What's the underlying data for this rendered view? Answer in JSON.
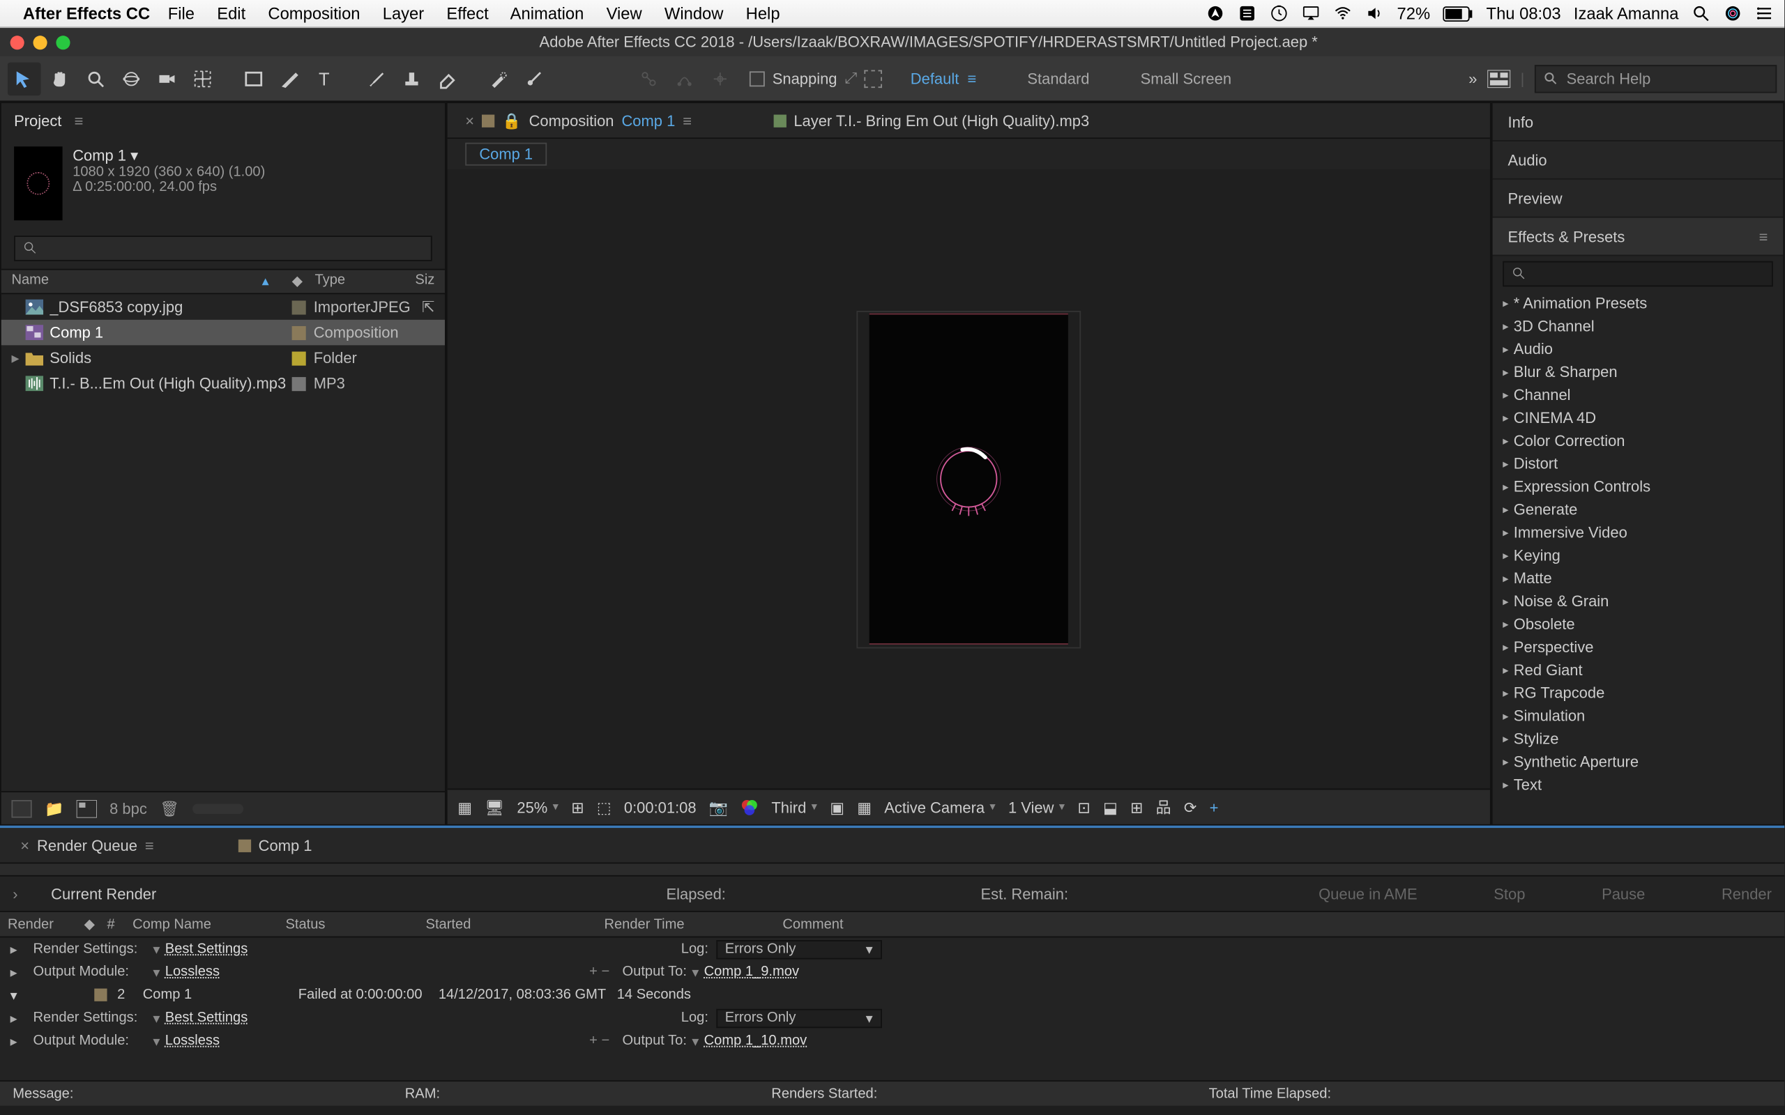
{
  "menubar": {
    "app": "After Effects CC",
    "items": [
      "File",
      "Edit",
      "Composition",
      "Layer",
      "Effect",
      "Animation",
      "View",
      "Window",
      "Help"
    ],
    "battery": "72%",
    "time": "Thu 08:03",
    "user": "Izaak Amanna"
  },
  "titlebar": {
    "title": "Adobe After Effects CC 2018 - /Users/Izaak/BOXRAW/IMAGES/SPOTIFY/HRDERASTSMRT/Untitled Project.aep *"
  },
  "toolbar": {
    "snapping": "Snapping",
    "workspaces": [
      "Default",
      "Standard",
      "Small Screen"
    ],
    "search_placeholder": "Search Help"
  },
  "project": {
    "panel_title": "Project",
    "comp_name": "Comp 1 ▾",
    "dims": "1080 x 1920  (360 x 640) (1.00)",
    "duration": "Δ 0:25:00:00, 24.00 fps",
    "cols": {
      "name": "Name",
      "label": "◆",
      "type": "Type",
      "size": "Siz"
    },
    "items": [
      {
        "name": "_DSF6853 copy.jpg",
        "type": "ImporterJPEG",
        "color": "#6b6753",
        "hasChild": false,
        "sel": false,
        "icon": "img"
      },
      {
        "name": "Comp 1",
        "type": "Composition",
        "color": "#8a7a5a",
        "hasChild": false,
        "sel": true,
        "icon": "comp"
      },
      {
        "name": "Solids",
        "type": "Folder",
        "color": "#b8a632",
        "hasChild": true,
        "sel": false,
        "icon": "folder"
      },
      {
        "name": "T.I.- B...Em Out (High Quality).mp3",
        "type": "MP3",
        "color": "#777",
        "hasChild": false,
        "sel": false,
        "icon": "audio"
      }
    ],
    "bpc": "8 bpc"
  },
  "composition": {
    "tab1_prefix": "Composition ",
    "tab1_name": "Comp 1",
    "tab2": "Layer T.I.- Bring Em Out (High Quality).mp3",
    "crumb": "Comp 1",
    "zoom": "25%",
    "time": "0:00:01:08",
    "quality": "Third",
    "camera": "Active Camera",
    "views": "1 View"
  },
  "right": {
    "panels": [
      "Info",
      "Audio",
      "Preview"
    ],
    "fx_title": "Effects & Presets",
    "fx": [
      "* Animation Presets",
      "3D Channel",
      "Audio",
      "Blur & Sharpen",
      "Channel",
      "CINEMA 4D",
      "Color Correction",
      "Distort",
      "Expression Controls",
      "Generate",
      "Immersive Video",
      "Keying",
      "Matte",
      "Noise & Grain",
      "Obsolete",
      "Perspective",
      "Red Giant",
      "RG Trapcode",
      "Simulation",
      "Stylize",
      "Synthetic Aperture",
      "Text"
    ]
  },
  "rq": {
    "tab1": "Render Queue",
    "tab2": "Comp 1",
    "current": "Current Render",
    "elapsed": "Elapsed:",
    "remain": "Est. Remain:",
    "btns": [
      "Queue in AME",
      "Stop",
      "Pause",
      "Render"
    ],
    "cols": {
      "render": "Render",
      "num": "#",
      "comp": "Comp Name",
      "status": "Status",
      "started": "Started",
      "rt": "Render Time",
      "comment": "Comment"
    },
    "rs": "Render Settings:",
    "best": "Best Settings",
    "log": "Log:",
    "errors": "Errors Only",
    "om": "Output Module:",
    "lossless": "Lossless",
    "ot": "Output To:",
    "file1": "Comp 1_9.mov",
    "file2": "Comp 1_10.mov",
    "item": {
      "num": "2",
      "name": "Comp 1",
      "status": "Failed at 0:00:00:00",
      "started": "14/12/2017, 08:03:36 GMT",
      "rt": "14 Seconds"
    },
    "foot": {
      "msg": "Message:",
      "ram": "RAM:",
      "rs": "Renders Started:",
      "tte": "Total Time Elapsed:"
    }
  }
}
